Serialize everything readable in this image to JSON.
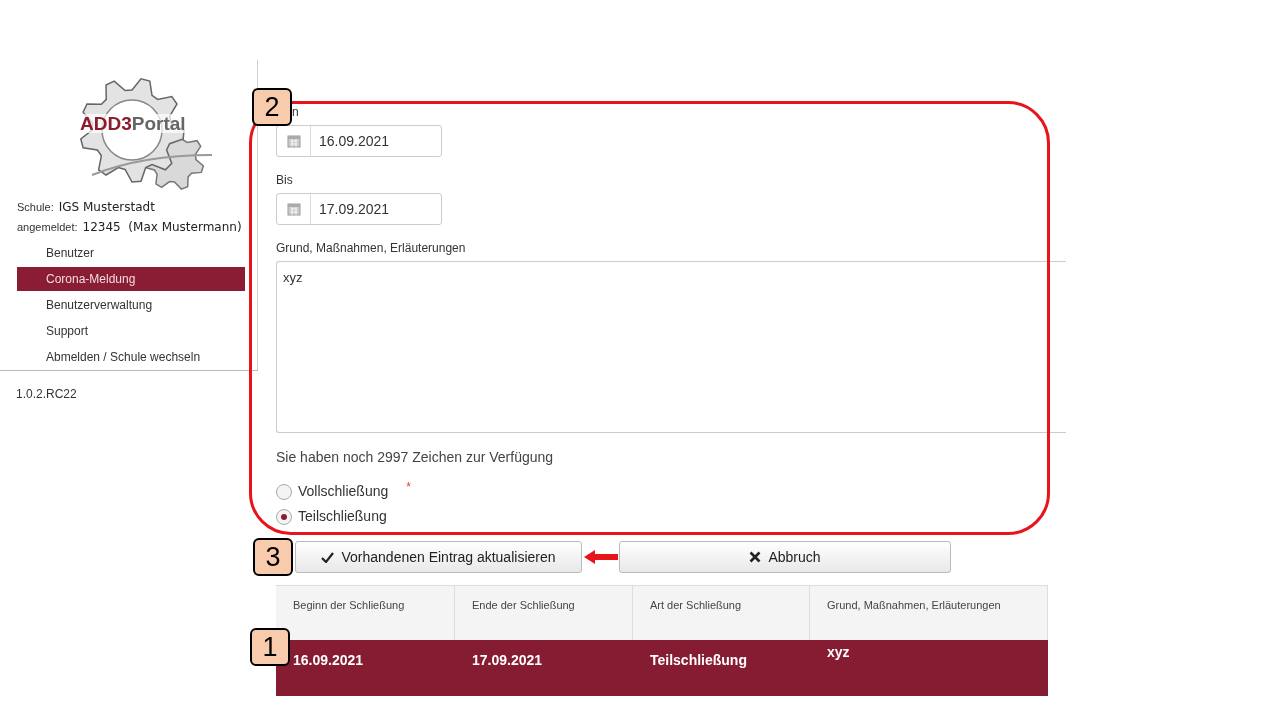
{
  "sidebar": {
    "logo": {
      "part_1": "ADD3",
      "part_2": "Portal"
    },
    "school": {
      "label": "Schule:",
      "value": "IGS Musterstadt"
    },
    "login": {
      "label": "angemeldet:",
      "value": "12345  (Max Mustermann)"
    },
    "items": [
      {
        "label": "Benutzer",
        "selected": false
      },
      {
        "label": "Corona-Meldung",
        "selected": true
      },
      {
        "label": "Benutzerverwaltung",
        "selected": false
      },
      {
        "label": "Support",
        "selected": false
      },
      {
        "label": "Abmelden / Schule wechseln",
        "selected": false
      }
    ],
    "version": "1.0.2.RC22"
  },
  "form": {
    "dates": [
      {
        "label": "n",
        "value": "16.09.2021"
      },
      {
        "label": "Bis",
        "value": "17.09.2021"
      }
    ],
    "reason": {
      "label": "Grund, Maßnahmen, Erläuterungen",
      "value": "xyz"
    },
    "counter": "Sie haben noch 2997 Zeichen zur Verfügung",
    "closure_type": {
      "required_mark": "*",
      "options": [
        {
          "label": "Vollschließung",
          "selected": false
        },
        {
          "label": "Teilschließung",
          "selected": true
        }
      ]
    }
  },
  "buttons": [
    {
      "kind": "confirm",
      "label": "Vorhandenen Eintrag aktualisieren"
    },
    {
      "kind": "cancel",
      "label": "Abbruch"
    }
  ],
  "table": {
    "columns": [
      "Beginn der Schließung",
      "Ende der Schließung",
      "Art der Schließung",
      "Grund, Maßnahmen, Erläuterungen"
    ],
    "rows": [
      {
        "selected": true,
        "cells": [
          "16.09.2021",
          "17.09.2021",
          "Teilschließung",
          "xyz"
        ]
      }
    ]
  },
  "annotations": {
    "callouts": [
      {
        "number": "2"
      },
      {
        "number": "3"
      },
      {
        "number": "1"
      }
    ]
  }
}
